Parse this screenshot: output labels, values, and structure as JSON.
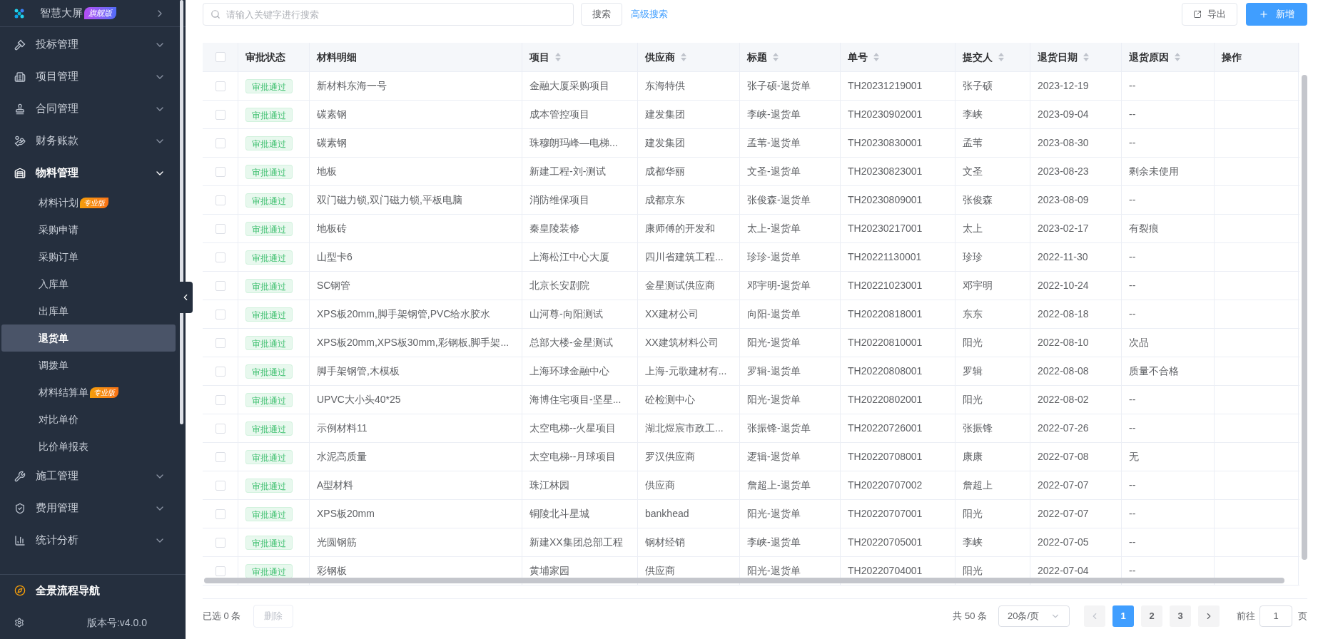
{
  "sidebar": {
    "top_item": {
      "label": "智慧大屏",
      "badge": "旗舰版"
    },
    "groups": [
      {
        "label": "投标管理",
        "expanded": false
      },
      {
        "label": "项目管理",
        "expanded": false
      },
      {
        "label": "合同管理",
        "expanded": false
      },
      {
        "label": "财务账款",
        "expanded": false
      },
      {
        "label": "物料管理",
        "expanded": true,
        "children": [
          {
            "label": "材料计划",
            "badge": "专业版",
            "selected": false
          },
          {
            "label": "采购申请",
            "selected": false
          },
          {
            "label": "采购订单",
            "selected": false
          },
          {
            "label": "入库单",
            "selected": false
          },
          {
            "label": "出库单",
            "selected": false
          },
          {
            "label": "退货单",
            "selected": true
          },
          {
            "label": "调拨单",
            "selected": false
          },
          {
            "label": "材料结算单",
            "badge": "专业版",
            "selected": false
          },
          {
            "label": "对比单价",
            "selected": false
          },
          {
            "label": "比价单报表",
            "selected": false
          }
        ]
      },
      {
        "label": "施工管理",
        "expanded": false
      },
      {
        "label": "费用管理",
        "expanded": false
      },
      {
        "label": "统计分析",
        "expanded": false
      }
    ],
    "nav_link": "全景流程导航",
    "version": "版本号:v4.0.0"
  },
  "toolbar": {
    "search": {
      "placeholder": "请输入关键字进行搜索"
    },
    "search_button": "搜索",
    "advanced_search": "高级搜索",
    "export_button": "导出",
    "add_button": "新增"
  },
  "table": {
    "select_all": {
      "checked": false
    },
    "columns": [
      {
        "label": "审批状态",
        "sortable": false
      },
      {
        "label": "材料明细",
        "sortable": false
      },
      {
        "label": "项目",
        "sortable": true
      },
      {
        "label": "供应商",
        "sortable": true
      },
      {
        "label": "标题",
        "sortable": true
      },
      {
        "label": "单号",
        "sortable": true
      },
      {
        "label": "提交人",
        "sortable": true
      },
      {
        "label": "退货日期",
        "sortable": true
      },
      {
        "label": "退货原因",
        "sortable": true
      },
      {
        "label": "操作",
        "sortable": false
      }
    ],
    "rows": [
      {
        "checked": false,
        "status": "审批通过",
        "material": "新材料东海一号",
        "project": "金融大厦采购项目",
        "supplier": "东海特供",
        "title": "张子硕-退货单",
        "number": "TH20231219001",
        "submitter": "张子硕",
        "date": "2023-12-19",
        "reason": "--"
      },
      {
        "checked": false,
        "status": "审批通过",
        "material": "碳素钢",
        "project": "成本管控项目",
        "supplier": "建发集团",
        "title": "李峡-退货单",
        "number": "TH20230902001",
        "submitter": "李峡",
        "date": "2023-09-04",
        "reason": "--"
      },
      {
        "checked": false,
        "status": "审批通过",
        "material": "碳素钢",
        "project": "珠穆朗玛峰—电梯...",
        "supplier": "建发集团",
        "title": "孟苇-退货单",
        "number": "TH20230830001",
        "submitter": "孟苇",
        "date": "2023-08-30",
        "reason": "--"
      },
      {
        "checked": false,
        "status": "审批通过",
        "material": "地板",
        "project": "新建工程-刘-测试",
        "supplier": "成都华丽",
        "title": "文圣-退货单",
        "number": "TH20230823001",
        "submitter": "文圣",
        "date": "2023-08-23",
        "reason": "剩余未使用"
      },
      {
        "checked": false,
        "status": "审批通过",
        "material": "双门磁力锁,双门磁力锁,平板电脑",
        "project": "消防维保项目",
        "supplier": "成都京东",
        "title": "张俊森-退货单",
        "number": "TH20230809001",
        "submitter": "张俊森",
        "date": "2023-08-09",
        "reason": "--"
      },
      {
        "checked": false,
        "status": "审批通过",
        "material": "地板砖",
        "project": "秦皇陵装修",
        "supplier": "康师傅的开发和",
        "title": "太上-退货单",
        "number": "TH20230217001",
        "submitter": "太上",
        "date": "2023-02-17",
        "reason": "有裂痕"
      },
      {
        "checked": false,
        "status": "审批通过",
        "material": "山型卡6",
        "project": "上海松江中心大厦",
        "supplier": "四川省建筑工程...",
        "title": "珍珍-退货单",
        "number": "TH20221130001",
        "submitter": "珍珍",
        "date": "2022-11-30",
        "reason": "--"
      },
      {
        "checked": false,
        "status": "审批通过",
        "material": "SC钢管",
        "project": "北京长安剧院",
        "supplier": "金星测试供应商",
        "title": "邓宇明-退货单",
        "number": "TH20221023001",
        "submitter": "邓宇明",
        "date": "2022-10-24",
        "reason": "--"
      },
      {
        "checked": false,
        "status": "审批通过",
        "material": "XPS板20mm,脚手架钢管,PVC给水胶水",
        "project": "山河尊-向阳测试",
        "supplier": "XX建材公司",
        "title": "向阳-退货单",
        "number": "TH20220818001",
        "submitter": "东东",
        "date": "2022-08-18",
        "reason": "--"
      },
      {
        "checked": false,
        "status": "审批通过",
        "material": "XPS板20mm,XPS板30mm,彩钢板,脚手架...",
        "project": "总部大楼-金星测试",
        "supplier": "XX建筑材料公司",
        "title": "阳光-退货单",
        "number": "TH20220810001",
        "submitter": "阳光",
        "date": "2022-08-10",
        "reason": "次品"
      },
      {
        "checked": false,
        "status": "审批通过",
        "material": "脚手架钢管,木模板",
        "project": "上海环球金融中心",
        "supplier": "上海-元歌建材有...",
        "title": "罗辑-退货单",
        "number": "TH20220808001",
        "submitter": "罗辑",
        "date": "2022-08-08",
        "reason": "质量不合格"
      },
      {
        "checked": false,
        "status": "审批通过",
        "material": "UPVC大小头40*25",
        "project": "海博住宅项目-坚星...",
        "supplier": "砼检测中心",
        "title": "阳光-退货单",
        "number": "TH20220802001",
        "submitter": "阳光",
        "date": "2022-08-02",
        "reason": "--"
      },
      {
        "checked": false,
        "status": "审批通过",
        "material": "示例材料11",
        "project": "太空电梯--火星项目",
        "supplier": "湖北煜宸市政工...",
        "title": "张振锋-退货单",
        "number": "TH20220726001",
        "submitter": "张振锋",
        "date": "2022-07-26",
        "reason": "--"
      },
      {
        "checked": false,
        "status": "审批通过",
        "material": "水泥高质量",
        "project": "太空电梯--月球项目",
        "supplier": "罗汉供应商",
        "title": "逻辑-退货单",
        "number": "TH20220708001",
        "submitter": "康康",
        "date": "2022-07-08",
        "reason": "无"
      },
      {
        "checked": false,
        "status": "审批通过",
        "material": "A型材料",
        "project": "珠江林园",
        "supplier": "供应商",
        "title": "詹超上-退货单",
        "number": "TH20220707002",
        "submitter": "詹超上",
        "date": "2022-07-07",
        "reason": "--"
      },
      {
        "checked": false,
        "status": "审批通过",
        "material": "XPS板20mm",
        "project": "铜陵北斗星城",
        "supplier": "bankhead",
        "title": "阳光-退货单",
        "number": "TH20220707001",
        "submitter": "阳光",
        "date": "2022-07-07",
        "reason": "--"
      },
      {
        "checked": false,
        "status": "审批通过",
        "material": "光圆钢筋",
        "project": "新建XX集团总部工程",
        "supplier": "钢材经销",
        "title": "李峡-退货单",
        "number": "TH20220705001",
        "submitter": "李峡",
        "date": "2022-07-05",
        "reason": "--"
      },
      {
        "checked": false,
        "status": "审批通过",
        "material": "彩钢板",
        "project": "黄埔家园",
        "supplier": "供应商",
        "title": "阳光-退货单",
        "number": "TH20220704001",
        "submitter": "阳光",
        "date": "2022-07-04",
        "reason": "--"
      }
    ]
  },
  "footer": {
    "selected_count": "已选 0 条",
    "delete_button": {
      "label": "删除",
      "disabled": true
    },
    "total": "共 50 条",
    "page_size": "20条/页",
    "pages": [
      {
        "label": "1",
        "selected": true
      },
      {
        "label": "2",
        "selected": false
      },
      {
        "label": "3",
        "selected": false
      }
    ],
    "goto_label": "前往",
    "goto_value": "1",
    "goto_suffix": "页"
  }
}
